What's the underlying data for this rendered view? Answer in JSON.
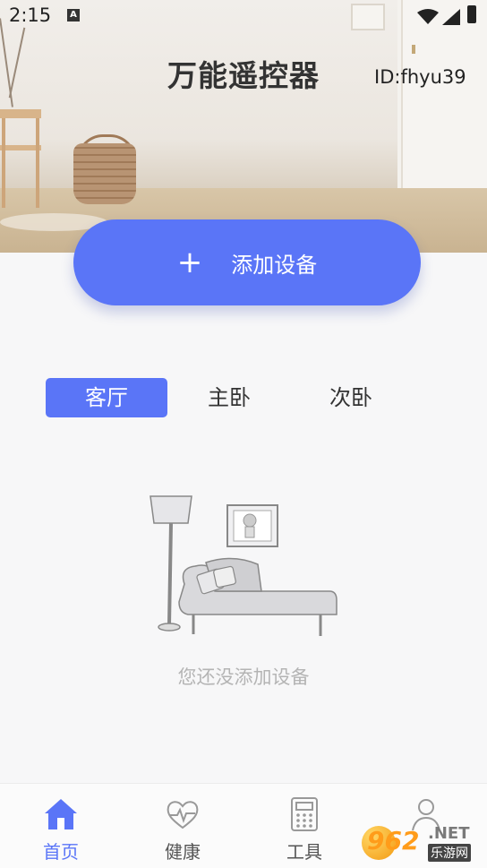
{
  "status_bar": {
    "time": "2:15",
    "notification_icon": "A"
  },
  "header": {
    "title": "万能遥控器",
    "user_id": "ID:fhyu39"
  },
  "add_device": {
    "icon": "plus-icon",
    "label": "添加设备"
  },
  "rooms": {
    "tabs": [
      {
        "label": "客厅",
        "active": true
      },
      {
        "label": "主卧",
        "active": false
      },
      {
        "label": "次卧",
        "active": false
      }
    ]
  },
  "empty_state": {
    "illustration": "sofa-lamp-illustration",
    "message": "您还没添加设备"
  },
  "bottom_nav": {
    "items": [
      {
        "label": "首页",
        "icon": "home-icon",
        "active": true
      },
      {
        "label": "健康",
        "icon": "heart-pulse-icon",
        "active": false
      },
      {
        "label": "工具",
        "icon": "calculator-icon",
        "active": false
      },
      {
        "label": "",
        "icon": "user-icon",
        "active": false
      }
    ]
  },
  "watermark": {
    "number": "962",
    "domain": ".NET",
    "site": "乐游网"
  },
  "colors": {
    "accent": "#5a75f7",
    "empty_text": "#b4b4b4"
  }
}
